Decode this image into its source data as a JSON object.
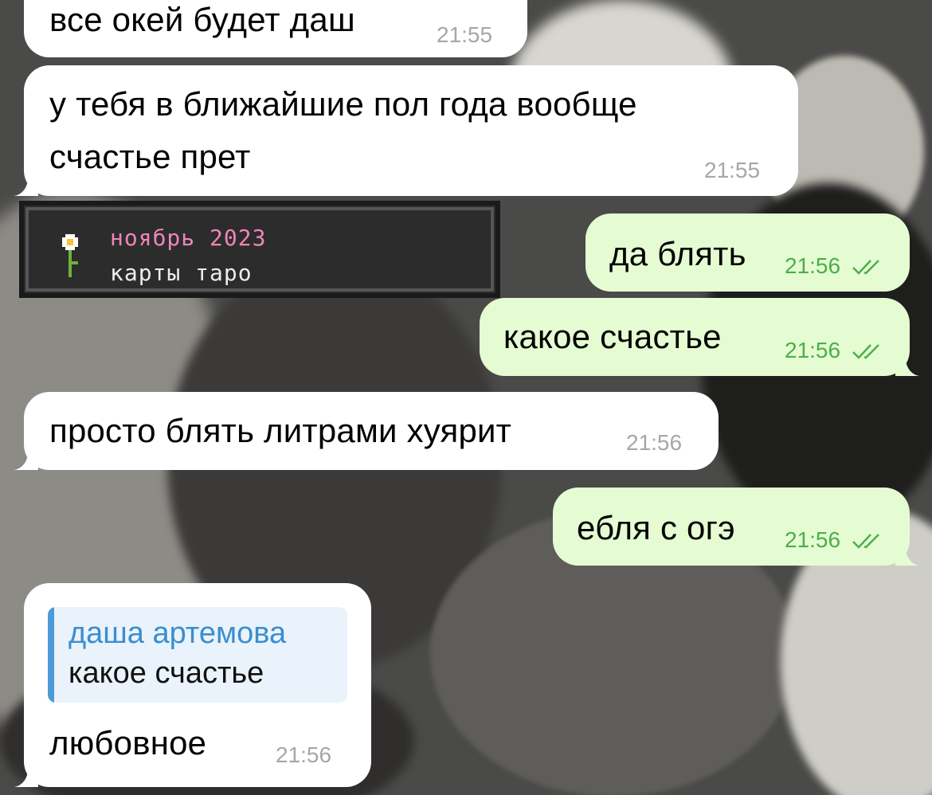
{
  "colors": {
    "incoming_bubble": "#ffffff",
    "outgoing_bubble": "#e5fcd3",
    "outgoing_time": "#4cae4a",
    "incoming_time": "#a7a7a7",
    "reply_accent": "#3a8ed0",
    "card_pink": "#ef86b6"
  },
  "messages": [
    {
      "text": "все окей будет даш",
      "time": "21:55"
    },
    {
      "text_line1": "у тебя в ближайшие пол года вообще",
      "text_line2": "счастье прет",
      "time": "21:55"
    },
    {
      "text": "да блять",
      "time": "21:56",
      "ticks_icon": "double-check-icon"
    },
    {
      "text": "какое счастье",
      "time": "21:56",
      "ticks_icon": "double-check-icon"
    },
    {
      "text": "просто блять литрами хуярит",
      "time": "21:56"
    },
    {
      "text": "ебля с огэ",
      "time": "21:56",
      "ticks_icon": "double-check-icon"
    },
    {
      "reply_author": "даша артемова",
      "reply_quote": "какое счастье",
      "text": "любовное",
      "time": "21:56"
    }
  ],
  "card": {
    "line1": "ноябрь 2023",
    "line2": "карты таро",
    "icon": "flower-icon"
  }
}
